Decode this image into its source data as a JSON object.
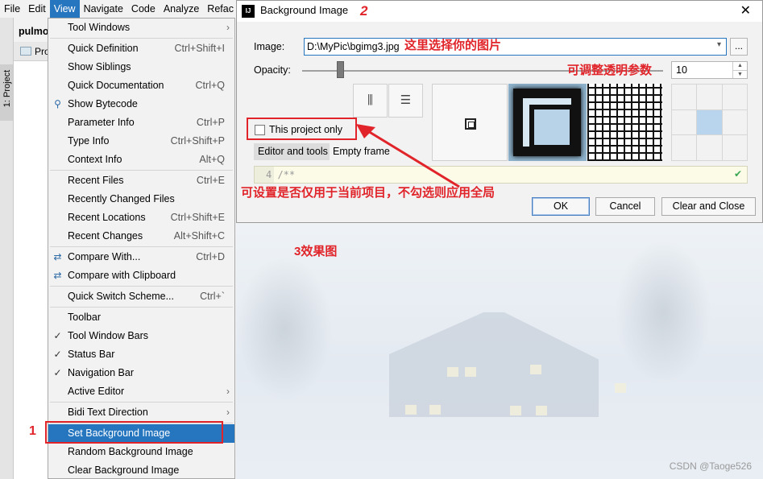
{
  "menubar": {
    "items": [
      "File",
      "Edit",
      "View",
      "Navigate",
      "Code",
      "Analyze",
      "Refac"
    ],
    "active": "View"
  },
  "project": {
    "name": "pulmor",
    "tab": "Pro",
    "strip_label": "1: Project"
  },
  "view_menu": {
    "items": [
      {
        "label": "Tool Windows",
        "shortcut": "",
        "submenu": true
      },
      {
        "label": "Quick Definition",
        "shortcut": "Ctrl+Shift+I"
      },
      {
        "label": "Show Siblings",
        "shortcut": ""
      },
      {
        "label": "Quick Documentation",
        "shortcut": "Ctrl+Q"
      },
      {
        "label": "Show Bytecode",
        "shortcut": "",
        "icon": "bytecode-icon"
      },
      {
        "label": "Parameter Info",
        "shortcut": "Ctrl+P"
      },
      {
        "label": "Type Info",
        "shortcut": "Ctrl+Shift+P"
      },
      {
        "label": "Context Info",
        "shortcut": "Alt+Q"
      },
      {
        "label": "Recent Files",
        "shortcut": "Ctrl+E"
      },
      {
        "label": "Recently Changed Files",
        "shortcut": ""
      },
      {
        "label": "Recent Locations",
        "shortcut": "Ctrl+Shift+E"
      },
      {
        "label": "Recent Changes",
        "shortcut": "Alt+Shift+C"
      },
      {
        "label": "Compare With...",
        "shortcut": "Ctrl+D",
        "icon": "compare-icon"
      },
      {
        "label": "Compare with Clipboard",
        "shortcut": "",
        "icon": "compare-clipboard-icon"
      },
      {
        "label": "Quick Switch Scheme...",
        "shortcut": "Ctrl+`"
      },
      {
        "label": "Toolbar",
        "shortcut": ""
      },
      {
        "label": "Tool Window Bars",
        "shortcut": "",
        "checked": true
      },
      {
        "label": "Status Bar",
        "shortcut": "",
        "checked": true
      },
      {
        "label": "Navigation Bar",
        "shortcut": "",
        "checked": true
      },
      {
        "label": "Active Editor",
        "shortcut": "",
        "submenu": true
      },
      {
        "label": "Bidi Text Direction",
        "shortcut": "",
        "submenu": true
      },
      {
        "label": "Set Background Image",
        "shortcut": "",
        "selected": true
      },
      {
        "label": "Random Background Image",
        "shortcut": ""
      },
      {
        "label": "Clear Background Image",
        "shortcut": ""
      }
    ]
  },
  "dialog": {
    "title": "Background Image",
    "close": "✕",
    "image_label": "Image:",
    "image_value": "D:\\MyPic\\bgimg3.jpg",
    "browse_label": "...",
    "opacity_label": "Opacity:",
    "opacity_value": "10",
    "this_project_only": "This project only",
    "tab_editor": "Editor and tools",
    "tab_frame": "Empty frame",
    "editor_line": "4 /**",
    "buttons": {
      "ok": "OK",
      "cancel": "Cancel",
      "clear_close": "Clear and Close"
    }
  },
  "annotations": {
    "step1": "1",
    "step2": "2",
    "step3": "3效果图",
    "choose_image": "这里选择你的图片",
    "opacity_hint": "可调整透明参数",
    "scope_hint": "可设置是否仅用于当前项目，不勾选则应用全局"
  },
  "watermark": "CSDN @Taoge526",
  "colors": {
    "accent": "#2675bf",
    "annotation_red": "#e0242a"
  }
}
